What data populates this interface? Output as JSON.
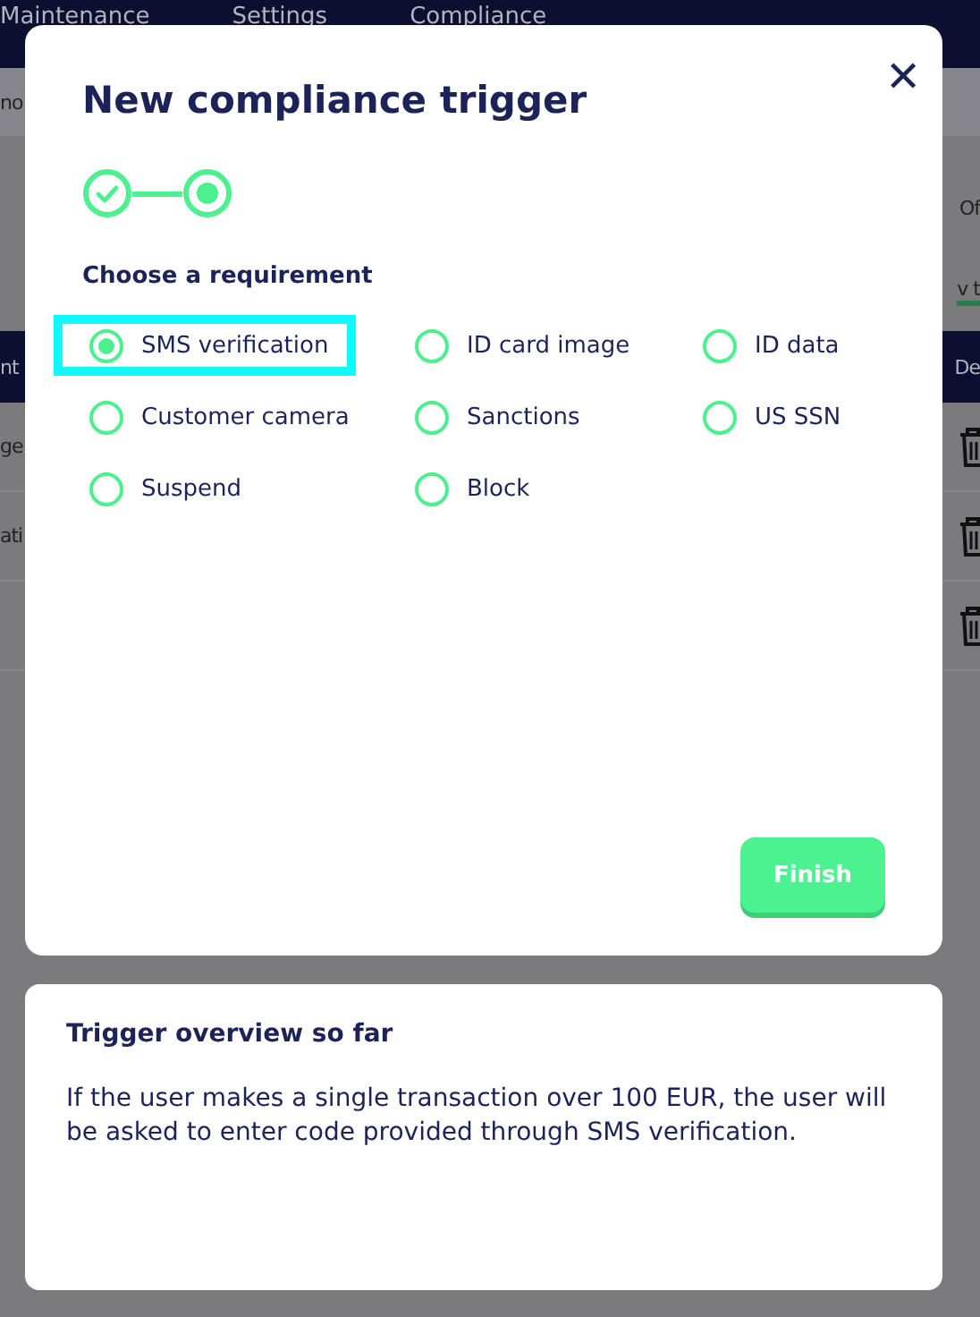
{
  "background": {
    "nav": [
      "Maintenance",
      "Settings",
      "Compliance"
    ],
    "fragments_left": [
      "no",
      "nt"
    ],
    "fragments_right": [
      "Of",
      "v t",
      "De"
    ],
    "table_rows": [
      {
        "cell": "ge"
      },
      {
        "cell": "ati"
      },
      {}
    ]
  },
  "dialog": {
    "title": "New compliance trigger",
    "close": "✕",
    "steps": [
      {
        "done": true
      },
      {
        "done": false
      }
    ],
    "section_label": "Choose a requirement",
    "options": [
      {
        "label": "SMS verification",
        "selected": true,
        "focused": true
      },
      {
        "label": "ID card image",
        "selected": false,
        "focused": false
      },
      {
        "label": "ID data",
        "selected": false,
        "focused": false
      },
      {
        "label": "Customer camera",
        "selected": false,
        "focused": false
      },
      {
        "label": "Sanctions",
        "selected": false,
        "focused": false
      },
      {
        "label": "US SSN",
        "selected": false,
        "focused": false
      },
      {
        "label": "Suspend",
        "selected": false,
        "focused": false
      },
      {
        "label": "Block",
        "selected": false,
        "focused": false
      }
    ],
    "finish": "Finish"
  },
  "overview": {
    "title": "Trigger overview so far",
    "text": "If the user makes a single transaction over 100 EUR, the user will be asked to enter code provided through SMS verification."
  }
}
